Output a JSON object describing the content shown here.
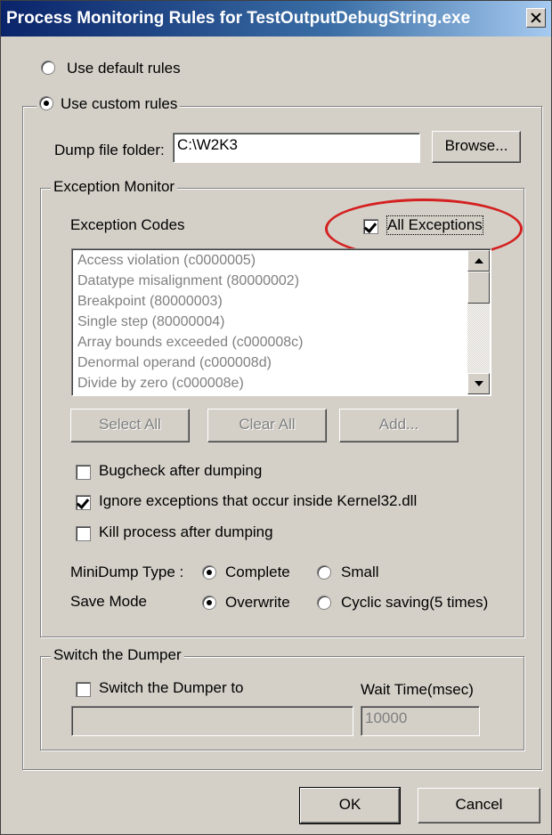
{
  "window": {
    "title": "Process Monitoring Rules for TestOutputDebugString.exe"
  },
  "rules": {
    "default_label": "Use default rules",
    "custom_label": "Use custom rules",
    "dump_folder_label": "Dump file folder:",
    "dump_folder_value": "C:\\W2K3",
    "browse_label": "Browse..."
  },
  "exception_monitor": {
    "group_label": "Exception Monitor",
    "codes_label": "Exception Codes",
    "all_exceptions_label": "All Exceptions",
    "all_exceptions_checked": true,
    "codes": [
      "Access violation (c0000005)",
      "Datatype misalignment (80000002)",
      "Breakpoint (80000003)",
      "Single step (80000004)",
      "Array bounds exceeded (c000008c)",
      "Denormal operand (c000008d)",
      "Divide by zero (c000008e)"
    ],
    "select_all_label": "Select All",
    "clear_all_label": "Clear All",
    "add_label": "Add...",
    "bugcheck_label": "Bugcheck after dumping",
    "ignore_kernel_label": "Ignore exceptions that occur inside Kernel32.dll",
    "kill_label": "Kill process after dumping",
    "minidump_label": "MiniDump Type :",
    "minidump_complete": "Complete",
    "minidump_small": "Small",
    "save_mode_label": "Save Mode",
    "save_overwrite": "Overwrite",
    "save_cyclic": "Cyclic saving(5 times)"
  },
  "dumper": {
    "group_label": "Switch the Dumper",
    "switch_label": "Switch the Dumper to",
    "wait_label": "Wait Time(msec)",
    "path_value": "",
    "wait_value": "10000"
  },
  "footer": {
    "ok_label": "OK",
    "cancel_label": "Cancel"
  },
  "colors": {
    "highlight_circle": "#d42020",
    "title_bar": "#0a246a"
  }
}
